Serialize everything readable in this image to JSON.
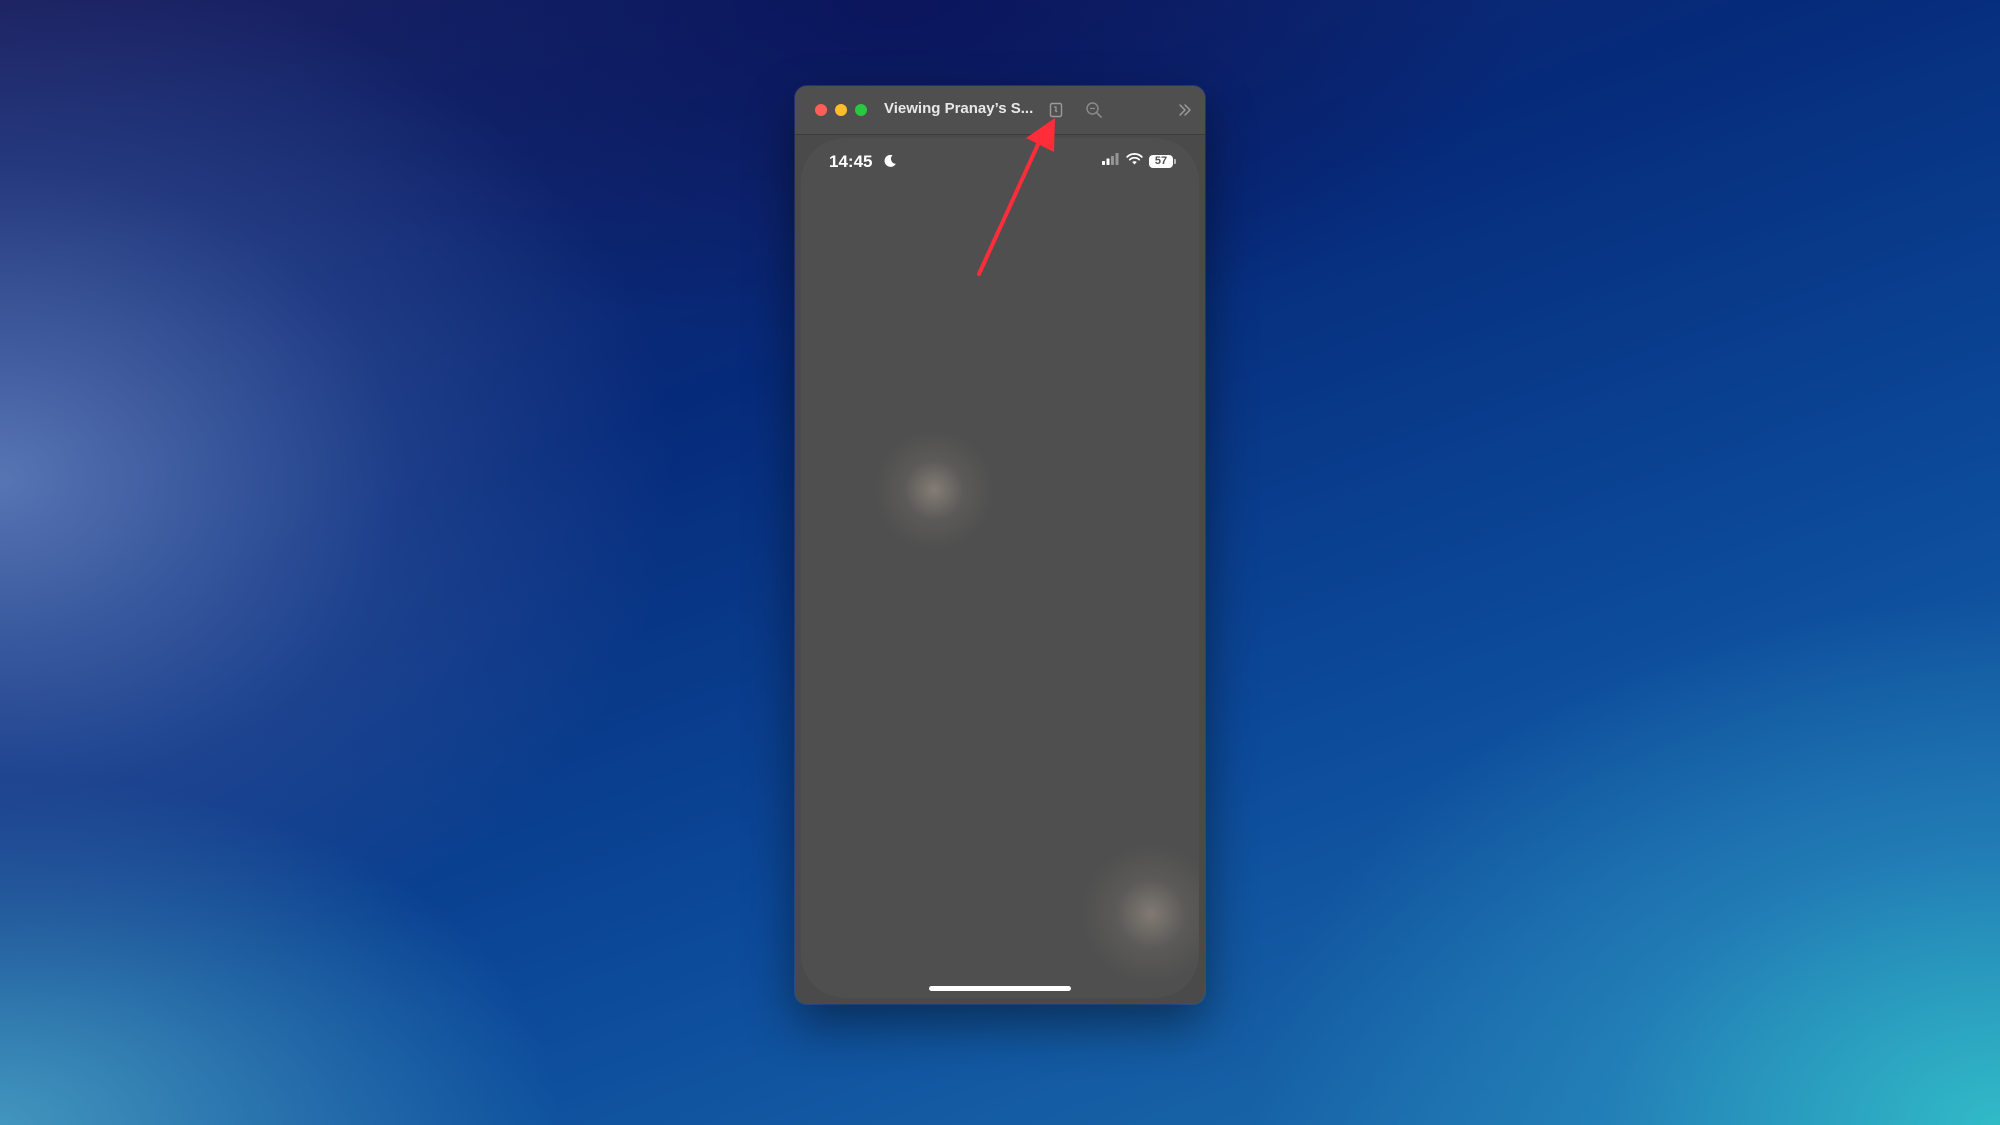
{
  "window": {
    "title": "Viewing Pranay’s S...",
    "buttons": {
      "close": "close-button",
      "minimize": "minimize-button",
      "maximize": "maximize-button"
    },
    "toolbar_icons": [
      "device-icon",
      "zoom-icon",
      "chevron-double-right-icon"
    ]
  },
  "phone": {
    "status_bar": {
      "time": "14:45",
      "focus_icon": "moon-icon",
      "signal_icon": "cellular-signal-icon",
      "wifi_icon": "wifi-icon",
      "battery_level": "57"
    }
  },
  "annotation": {
    "arrow_color": "#ff2d3a"
  },
  "colors": {
    "close": "#ff5f57",
    "minimize": "#febc2e",
    "maximize": "#28c840"
  }
}
